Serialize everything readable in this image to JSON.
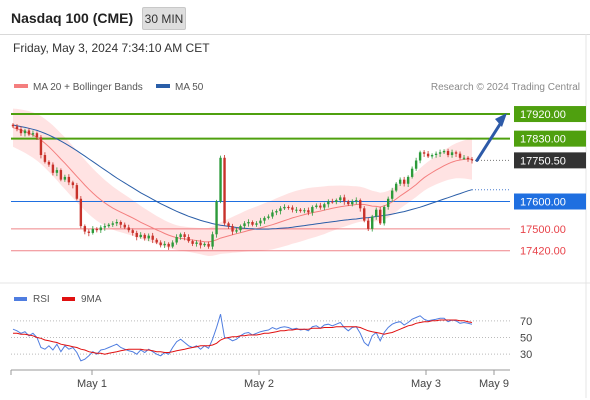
{
  "header": {
    "title": "Nasdaq 100 (CME)",
    "timeframe": "30 MIN",
    "datetime": "Friday, May 3, 2024 7:34:10 AM CET"
  },
  "legend": {
    "ma20": "MA 20 + Bollinger Bands",
    "ma50": "MA 50",
    "ma20_color": "#f47e7e",
    "ma50_color": "#2a5ea8"
  },
  "watermark": "Research © 2024 Trading Central",
  "levels": [
    {
      "label": "17920.00",
      "kind": "target",
      "color": "#4fa00f"
    },
    {
      "label": "17830.00",
      "kind": "target",
      "color": "#4fa00f"
    },
    {
      "label": "17750.50",
      "kind": "last",
      "color": "#333333"
    },
    {
      "label": "17600.00",
      "kind": "pivot",
      "color": "#1f6fe0"
    },
    {
      "label": "17500.00",
      "kind": "support",
      "color": "#e8434a"
    },
    {
      "label": "17420.00",
      "kind": "support",
      "color": "#e8434a"
    }
  ],
  "rsi_legend": {
    "rsi": "RSI",
    "ma": "9MA",
    "rsi_color": "#4f7de0",
    "ma_color": "#e01010"
  },
  "rsi_ticks": [
    "70",
    "50",
    "30"
  ],
  "x_labels": [
    "May 1",
    "May 2",
    "May 3",
    "May 9"
  ],
  "chart_data": {
    "type": "candlestick",
    "title": "Nasdaq 100 (CME)",
    "timeframe": "30 MIN",
    "price_levels": [
      17920.0,
      17830.0,
      17750.5,
      17600.0,
      17500.0,
      17420.0
    ],
    "last_price": 17750.5,
    "pivot": 17600.0,
    "targets": [
      17830.0,
      17920.0
    ],
    "supports": [
      17500.0,
      17420.0
    ],
    "closes": [
      17875,
      17865,
      17850,
      17860,
      17845,
      17850,
      17835,
      17770,
      17745,
      17735,
      17705,
      17715,
      17680,
      17690,
      17670,
      17660,
      17610,
      17510,
      17490,
      17485,
      17500,
      17495,
      17505,
      17510,
      17515,
      17520,
      17525,
      17515,
      17505,
      17495,
      17485,
      17470,
      17478,
      17465,
      17475,
      17460,
      17450,
      17440,
      17445,
      17435,
      17450,
      17470,
      17480,
      17470,
      17455,
      17445,
      17450,
      17440,
      17445,
      17435,
      17480,
      17600,
      17760,
      17520,
      17510,
      17490,
      17495,
      17510,
      17520,
      17525,
      17515,
      17520,
      17530,
      17540,
      17545,
      17560,
      17565,
      17575,
      17580,
      17578,
      17570,
      17570,
      17565,
      17568,
      17560,
      17580,
      17585,
      17578,
      17590,
      17600,
      17598,
      17605,
      17615,
      17600,
      17590,
      17600,
      17605,
      17575,
      17530,
      17500,
      17545,
      17570,
      17520,
      17580,
      17610,
      17640,
      17665,
      17680,
      17665,
      17690,
      17720,
      17750,
      17780,
      17775,
      17765,
      17770,
      17775,
      17780,
      17785,
      17770,
      17780,
      17775,
      17760,
      17760,
      17755,
      17751
    ],
    "ma20": [
      17870,
      17866,
      17861,
      17856,
      17850,
      17843,
      17835,
      17825,
      17813,
      17800,
      17786,
      17771,
      17755,
      17740,
      17724,
      17708,
      17692,
      17676,
      17660,
      17645,
      17631,
      17618,
      17606,
      17595,
      17585,
      17576,
      17568,
      17561,
      17554,
      17547,
      17540,
      17532,
      17524,
      17517,
      17510,
      17503,
      17496,
      17490,
      17483,
      17477,
      17472,
      17468,
      17465,
      17463,
      17461,
      17459,
      17457,
      17455,
      17453,
      17452,
      17455,
      17460,
      17466,
      17470,
      17474,
      17478,
      17482,
      17486,
      17490,
      17494,
      17497,
      17500,
      17503,
      17507,
      17511,
      17515,
      17520,
      17525,
      17530,
      17535,
      17540,
      17544,
      17548,
      17552,
      17556,
      17559,
      17562,
      17565,
      17568,
      17572,
      17575,
      17578,
      17581,
      17583,
      17585,
      17587,
      17589,
      17590,
      17589,
      17586,
      17583,
      17582,
      17580,
      17584,
      17590,
      17599,
      17609,
      17620,
      17630,
      17640,
      17651,
      17662,
      17675,
      17687,
      17697,
      17706,
      17715,
      17723,
      17731,
      17738,
      17744,
      17749,
      17752,
      17754,
      17755,
      17755
    ],
    "ma50": [
      17880,
      17877,
      17874,
      17871,
      17868,
      17864,
      17860,
      17855,
      17849,
      17843,
      17836,
      17829,
      17821,
      17813,
      17804,
      17795,
      17786,
      17776,
      17766,
      17756,
      17746,
      17736,
      17726,
      17716,
      17706,
      17696,
      17686,
      17677,
      17668,
      17659,
      17650,
      17641,
      17632,
      17624,
      17616,
      17608,
      17600,
      17592,
      17585,
      17578,
      17571,
      17564,
      17558,
      17552,
      17546,
      17541,
      17536,
      17531,
      17527,
      17523,
      17519,
      17516,
      17513,
      17511,
      17509,
      17507,
      17505,
      17503,
      17502,
      17501,
      17500,
      17499,
      17499,
      17499,
      17499,
      17500,
      17501,
      17502,
      17503,
      17504,
      17506,
      17508,
      17510,
      17512,
      17514,
      17516,
      17518,
      17520,
      17522,
      17524,
      17526,
      17528,
      17530,
      17532,
      17533,
      17535,
      17536,
      17538,
      17540,
      17541,
      17543,
      17545,
      17547,
      17549,
      17551,
      17554,
      17557,
      17560,
      17563,
      17567,
      17571,
      17575,
      17579,
      17584,
      17589,
      17594,
      17599,
      17604,
      17609,
      17614,
      17619,
      17624,
      17629,
      17634,
      17639,
      17643
    ],
    "rsi": [
      60,
      58,
      55,
      57,
      52,
      55,
      50,
      38,
      36,
      40,
      35,
      42,
      33,
      40,
      36,
      38,
      32,
      22,
      24,
      28,
      33,
      30,
      35,
      36,
      38,
      40,
      42,
      38,
      36,
      34,
      33,
      30,
      35,
      32,
      36,
      33,
      30,
      28,
      32,
      30,
      38,
      45,
      48,
      44,
      40,
      38,
      40,
      36,
      40,
      37,
      48,
      62,
      78,
      50,
      49,
      46,
      48,
      52,
      55,
      56,
      53,
      55,
      57,
      58,
      59,
      62,
      60,
      62,
      63,
      62,
      60,
      61,
      59,
      60,
      58,
      63,
      64,
      61,
      65,
      66,
      64,
      66,
      68,
      62,
      58,
      62,
      63,
      55,
      44,
      40,
      52,
      56,
      46,
      56,
      62,
      66,
      68,
      69,
      65,
      68,
      72,
      74,
      76,
      72,
      70,
      71,
      72,
      73,
      73,
      69,
      71,
      70,
      67,
      68,
      67,
      66
    ],
    "rsi_ma": [
      55,
      55,
      54,
      54,
      53,
      52,
      50,
      49,
      47,
      46,
      45,
      44,
      42,
      41,
      40,
      39,
      38,
      36,
      35,
      33,
      32,
      31,
      31,
      30,
      31,
      32,
      33,
      34,
      35,
      36,
      36,
      36,
      36,
      35,
      35,
      34,
      33,
      33,
      32,
      32,
      33,
      34,
      35,
      36,
      37,
      38,
      39,
      40,
      40,
      40,
      41,
      43,
      47,
      49,
      50,
      51,
      51,
      52,
      52,
      53,
      53,
      53,
      54,
      55,
      55,
      56,
      57,
      58,
      58,
      59,
      59,
      60,
      60,
      60,
      60,
      61,
      61,
      61,
      62,
      62,
      62,
      63,
      63,
      63,
      63,
      63,
      63,
      62,
      60,
      58,
      57,
      56,
      55,
      54,
      55,
      56,
      58,
      60,
      62,
      64,
      65,
      67,
      68,
      69,
      69,
      70,
      70,
      71,
      71,
      71,
      71,
      71,
      70,
      70,
      69,
      68
    ],
    "rsi_levels": [
      70,
      50,
      30
    ],
    "x_labels": [
      "May 1",
      "May 2",
      "May 3",
      "May 9"
    ],
    "legend_placement": "top-left",
    "grid": false
  }
}
